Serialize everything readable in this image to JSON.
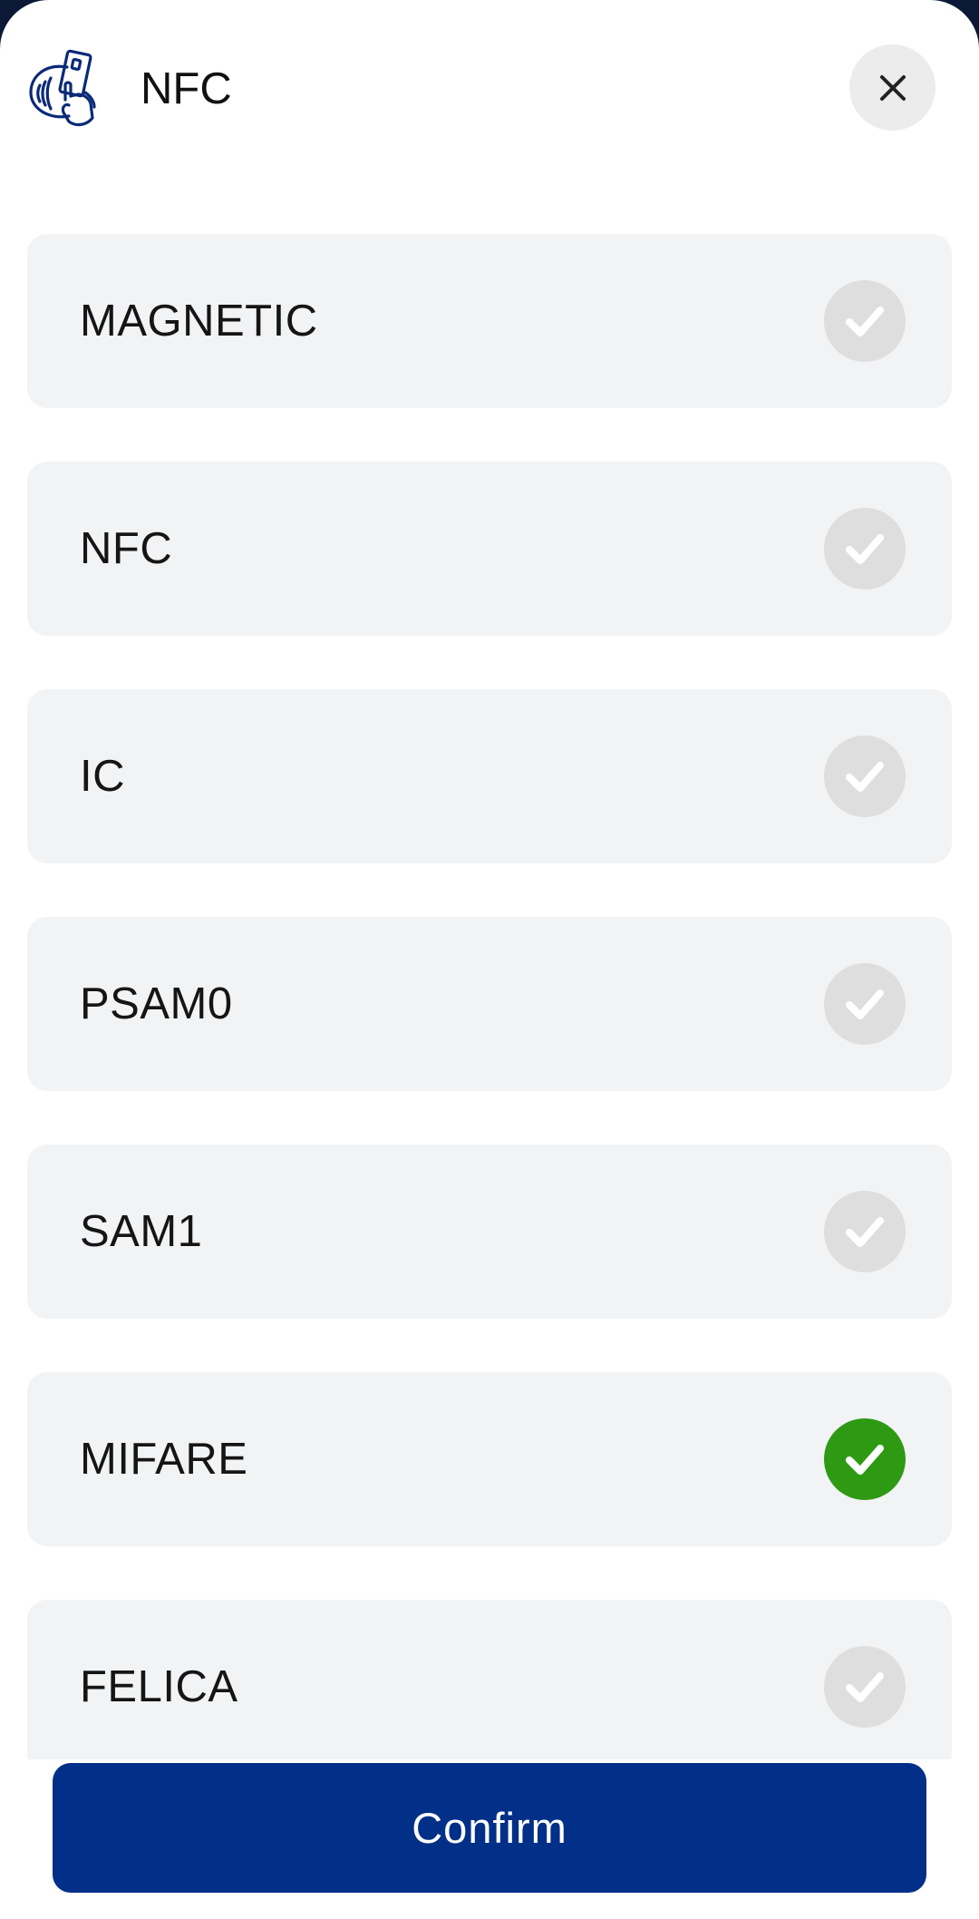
{
  "header": {
    "title": "NFC",
    "icon": "contactless-card-icon",
    "close_icon": "close-icon"
  },
  "options": [
    {
      "label": "MAGNETIC",
      "selected": false
    },
    {
      "label": "NFC",
      "selected": false
    },
    {
      "label": "IC",
      "selected": false
    },
    {
      "label": "PSAM0",
      "selected": false
    },
    {
      "label": "SAM1",
      "selected": false
    },
    {
      "label": "MIFARE",
      "selected": true
    },
    {
      "label": "FELICA",
      "selected": false
    }
  ],
  "footer": {
    "confirm_label": "Confirm"
  },
  "colors": {
    "primary": "#022f87",
    "selected_check": "#2e9a14",
    "unselected_check": "#dedede",
    "option_bg": "#f2f3f5"
  }
}
